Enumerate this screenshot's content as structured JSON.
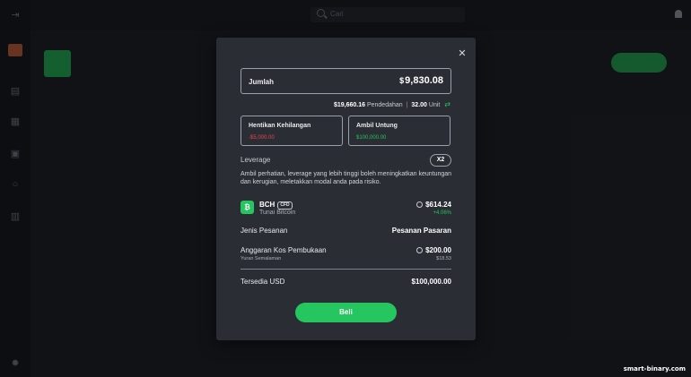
{
  "topbar": {
    "search_placeholder": "Cari"
  },
  "modal": {
    "amount": {
      "label": "Jumlah",
      "currency_symbol": "$",
      "value": "9,830.08"
    },
    "summary": {
      "leverage_amount": "$19,660.16",
      "leverage_label": "Pendedahan",
      "separator": "|",
      "units": "32.00",
      "units_label": "Unit"
    },
    "stop_loss": {
      "label": "Hentikan Kehilangan",
      "value": "-$5,000.00"
    },
    "take_profit": {
      "label": "Ambil Untung",
      "value": "$100,000.00"
    },
    "leverage": {
      "label": "Leverage",
      "badge": "X2",
      "warning": "Ambil perhatian, leverage yang lebih tinggi boleh meningkatkan keuntungan dan kerugian, meletakkan modal anda pada risiko."
    },
    "asset": {
      "symbol": "BCH",
      "tag": "CFD",
      "name": "Tunai Bitcoin",
      "price": "$614.24",
      "change": "+4.06%"
    },
    "order_type": {
      "label": "Jenis Pesanan",
      "value": "Pesanan Pasaran"
    },
    "opening_cost": {
      "label": "Anggaran Kos Pembukaan",
      "value": "$200.00",
      "overnight_label": "Yuran Semalaman",
      "overnight_value": "$18.53"
    },
    "available": {
      "label": "Tersedia USD",
      "value": "$100,000.00"
    },
    "buy_label": "Beli"
  },
  "watermark": "smart-binary.com",
  "colors": {
    "accent": "#25c55f",
    "negative": "#e5484d",
    "background": "#1d2026",
    "modal": "#2a2d34"
  }
}
